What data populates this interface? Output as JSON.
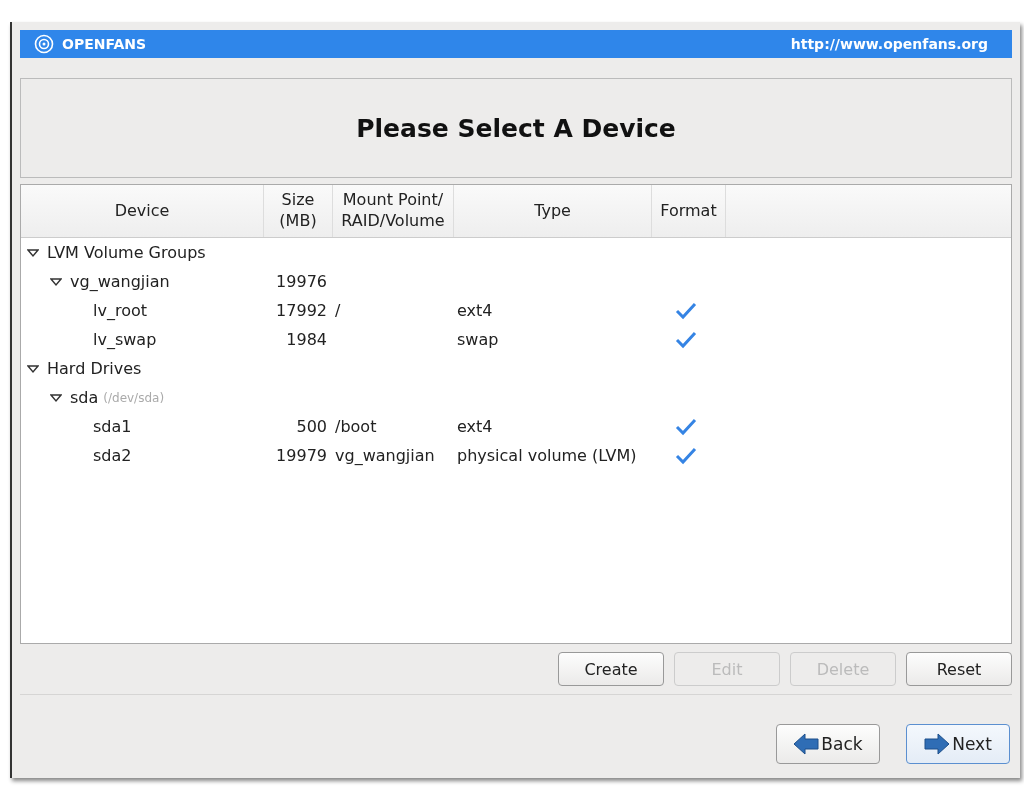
{
  "banner": {
    "brand": "OPENFANS",
    "url": "http://www.openfans.org"
  },
  "heading": "Please Select A Device",
  "table": {
    "columns": [
      "Device",
      "Size\n(MB)",
      "Mount Point/\nRAID/Volume",
      "Type",
      "Format"
    ],
    "rows": [
      {
        "name": "LVM Volume Groups",
        "expanded": true,
        "children": [
          {
            "name": "vg_wangjian",
            "size": "19976",
            "expanded": true,
            "children": [
              {
                "name": "lv_root",
                "size": "17992",
                "mount": "/",
                "type": "ext4",
                "format": true
              },
              {
                "name": "lv_swap",
                "size": "1984",
                "type": "swap",
                "format": true
              }
            ]
          }
        ]
      },
      {
        "name": "Hard Drives",
        "expanded": true,
        "children": [
          {
            "name": "sda",
            "note": "(/dev/sda)",
            "expanded": true,
            "children": [
              {
                "name": "sda1",
                "size": "500",
                "mount": "/boot",
                "type": "ext4",
                "format": true
              },
              {
                "name": "sda2",
                "size": "19979",
                "mount": "vg_wangjian",
                "type": "physical volume (LVM)",
                "format": true
              }
            ]
          }
        ]
      }
    ]
  },
  "actions": [
    {
      "label": "Create",
      "disabled": false
    },
    {
      "label": "Edit",
      "disabled": true
    },
    {
      "label": "Delete",
      "disabled": true
    },
    {
      "label": "Reset",
      "disabled": false
    }
  ],
  "navigation": [
    {
      "label": "Back",
      "kind": "back",
      "focused": false
    },
    {
      "label": "Next",
      "kind": "next",
      "focused": true
    }
  ]
}
